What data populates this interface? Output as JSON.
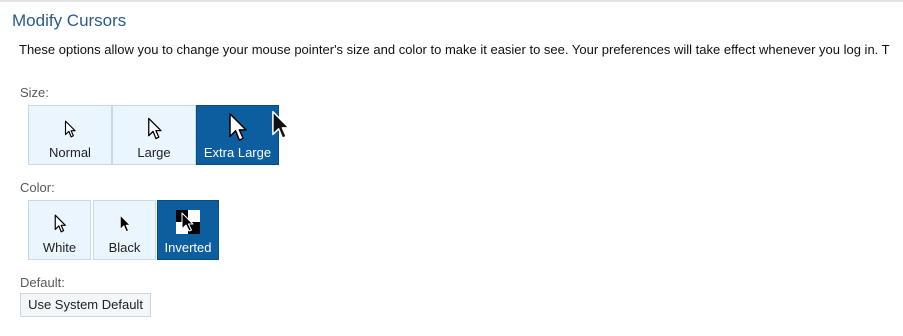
{
  "page": {
    "title": "Modify Cursors",
    "description": "These options allow you to change your mouse pointer's size and color to make it easier to see. Your preferences will take effect whenever you log in. T"
  },
  "size_group": {
    "label": "Size:",
    "options": [
      {
        "label": "Normal",
        "icon": "cursor-arrow-white-small-icon",
        "selected": false
      },
      {
        "label": "Large",
        "icon": "cursor-arrow-white-medium-icon",
        "selected": false
      },
      {
        "label": "Extra Large",
        "icon": "cursor-arrow-white-large-icon",
        "selected": true
      }
    ]
  },
  "color_group": {
    "label": "Color:",
    "options": [
      {
        "label": "White",
        "icon": "cursor-arrow-white-icon",
        "selected": false
      },
      {
        "label": "Black",
        "icon": "cursor-arrow-black-icon",
        "selected": false
      },
      {
        "label": "Inverted",
        "icon": "cursor-arrow-inverted-icon",
        "selected": true
      }
    ]
  },
  "default_group": {
    "label": "Default:",
    "button": "Use System Default"
  },
  "colors": {
    "title": "#2b5a8c",
    "selected_bg": "#0d5e9f",
    "option_bg": "#eaf5fd",
    "option_border": "#c6dbea"
  }
}
